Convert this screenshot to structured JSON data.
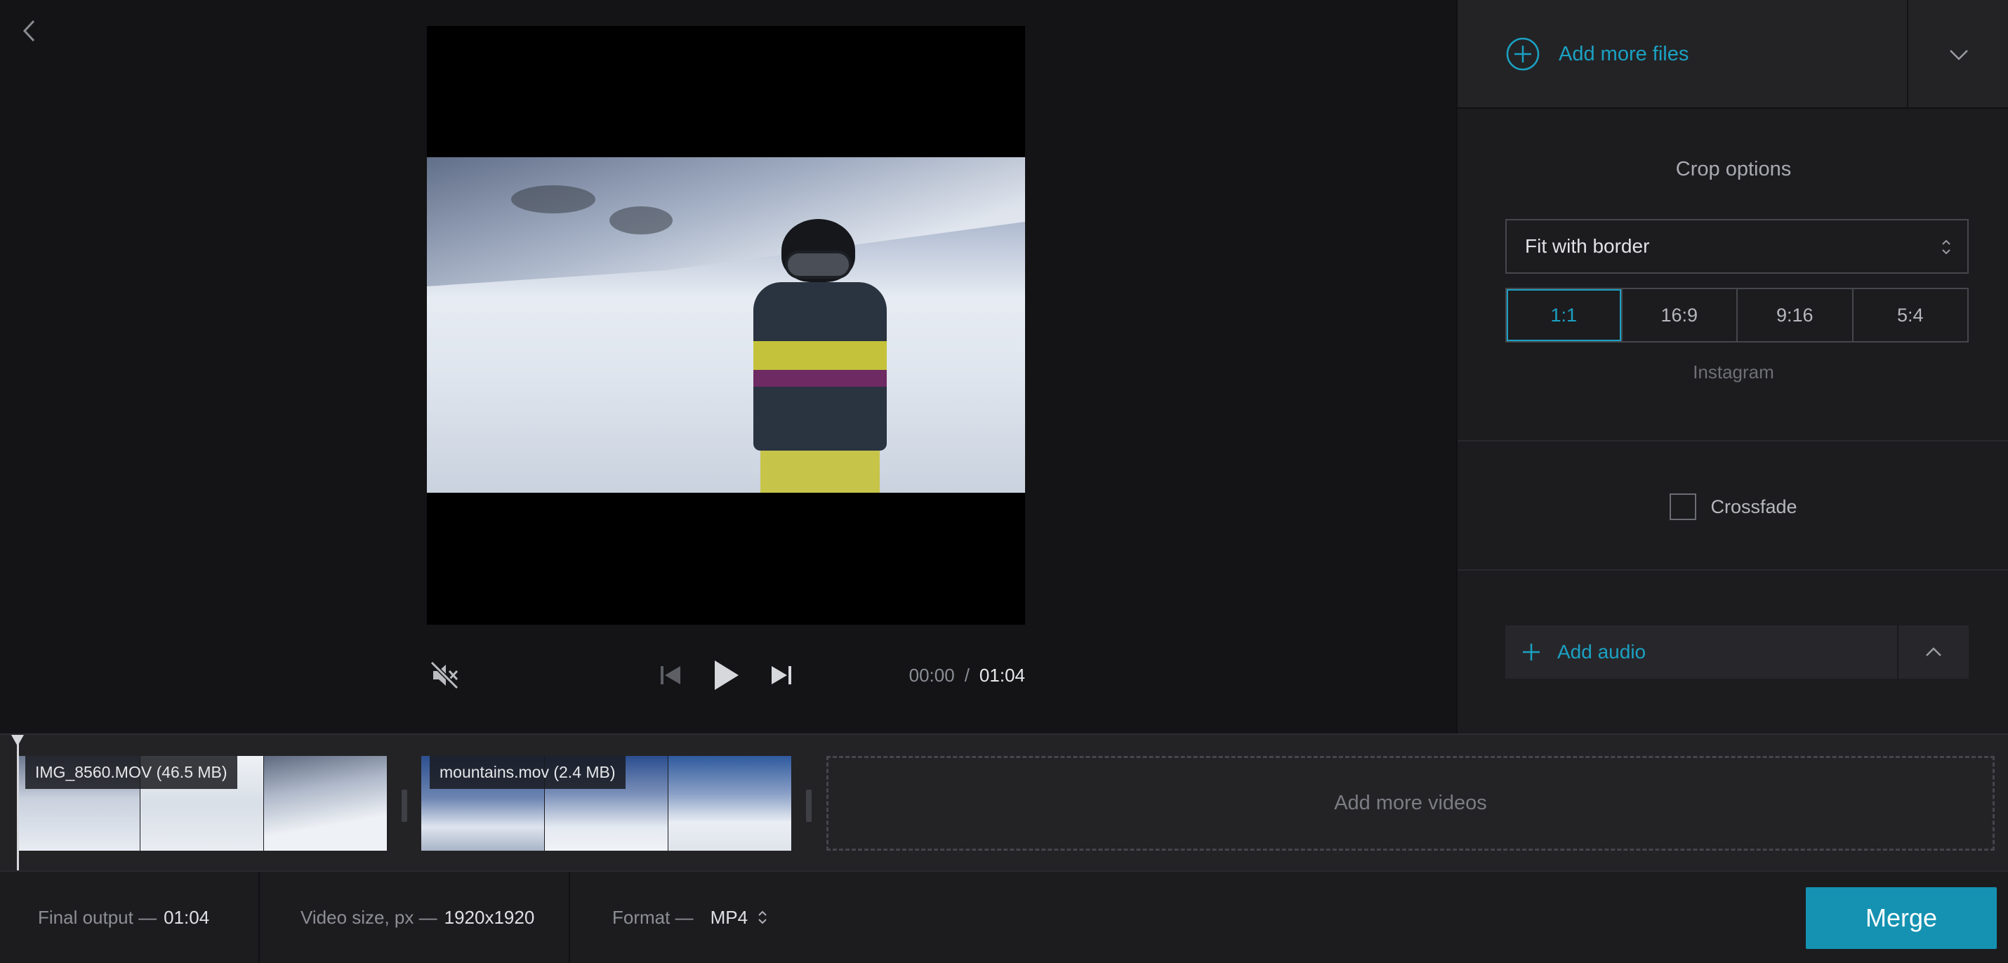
{
  "preview": {
    "time_current": "00:00",
    "time_separator": "/",
    "time_total": "01:04"
  },
  "panel": {
    "add_files_label": "Add more files",
    "crop_title": "Crop options",
    "crop_select_value": "Fit with border",
    "ratios": [
      "1:1",
      "16:9",
      "9:16",
      "5:4"
    ],
    "active_ratio": "1:1",
    "ratio_hint": "Instagram",
    "crossfade_label": "Crossfade",
    "crossfade_checked": false,
    "add_audio_label": "Add audio"
  },
  "timeline": {
    "clips": [
      {
        "name": "IMG_8560.MOV (46.5 MB)"
      },
      {
        "name": "mountains.mov (2.4 MB)"
      }
    ],
    "add_videos_label": "Add more videos"
  },
  "footer": {
    "final_output_label": "Final output —",
    "final_output_value": "01:04",
    "video_size_label": "Video size, px —",
    "video_size_value": "1920x1920",
    "format_label": "Format —",
    "format_value": "MP4",
    "merge_label": "Merge"
  },
  "colors": {
    "accent": "#1ba1c2",
    "merge_button": "#1592b2",
    "background": "#141416",
    "panel": "#1c1c1f"
  }
}
